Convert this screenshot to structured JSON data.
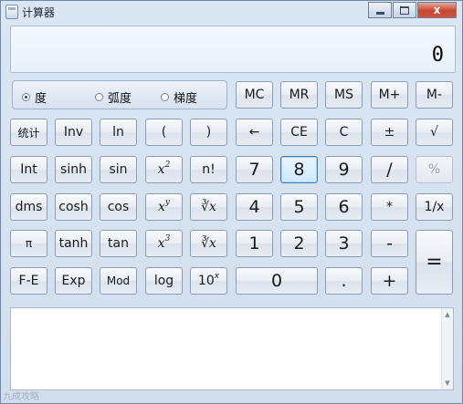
{
  "window": {
    "title": "计算器",
    "minimize_label": "",
    "maximize_label": "",
    "close_label": "x"
  },
  "display": {
    "value": "0"
  },
  "angle_modes": {
    "selected": "度",
    "options": [
      "度",
      "弧度",
      "梯度"
    ]
  },
  "memory": [
    "MC",
    "MR",
    "MS",
    "M+",
    "M-"
  ],
  "buttons": {
    "stats": "统计",
    "inv": "Inv",
    "ln": "ln",
    "lparen": "(",
    "rparen": ")",
    "backspace": "←",
    "ce": "CE",
    "clear": "C",
    "plusminus": "±",
    "sqrt": "√",
    "int": "Int",
    "sinh": "sinh",
    "sin": "sin",
    "x2": "x",
    "x2_sup": "2",
    "fact": "n!",
    "n7": "7",
    "n8": "8",
    "n9": "9",
    "div": "/",
    "pct": "%",
    "dms": "dms",
    "cosh": "cosh",
    "cos": "cos",
    "xy": "x",
    "xy_sup": "y",
    "yroot": "∛x",
    "n4": "4",
    "n5": "5",
    "n6": "6",
    "mul": "*",
    "recip": "1/x",
    "pi": "π",
    "tanh": "tanh",
    "tan": "tan",
    "x3": "x",
    "x3_sup": "3",
    "cbrt": "∛x",
    "n1": "1",
    "n2": "2",
    "n3": "3",
    "sub": "-",
    "eq": "=",
    "fe": "F-E",
    "exp": "Exp",
    "mod": "Mod",
    "log": "log",
    "tenx": "10",
    "tenx_sup": "x",
    "n0": "0",
    "dot": ".",
    "add": "+"
  },
  "history": {
    "entries": []
  },
  "watermark": "九成攻略"
}
